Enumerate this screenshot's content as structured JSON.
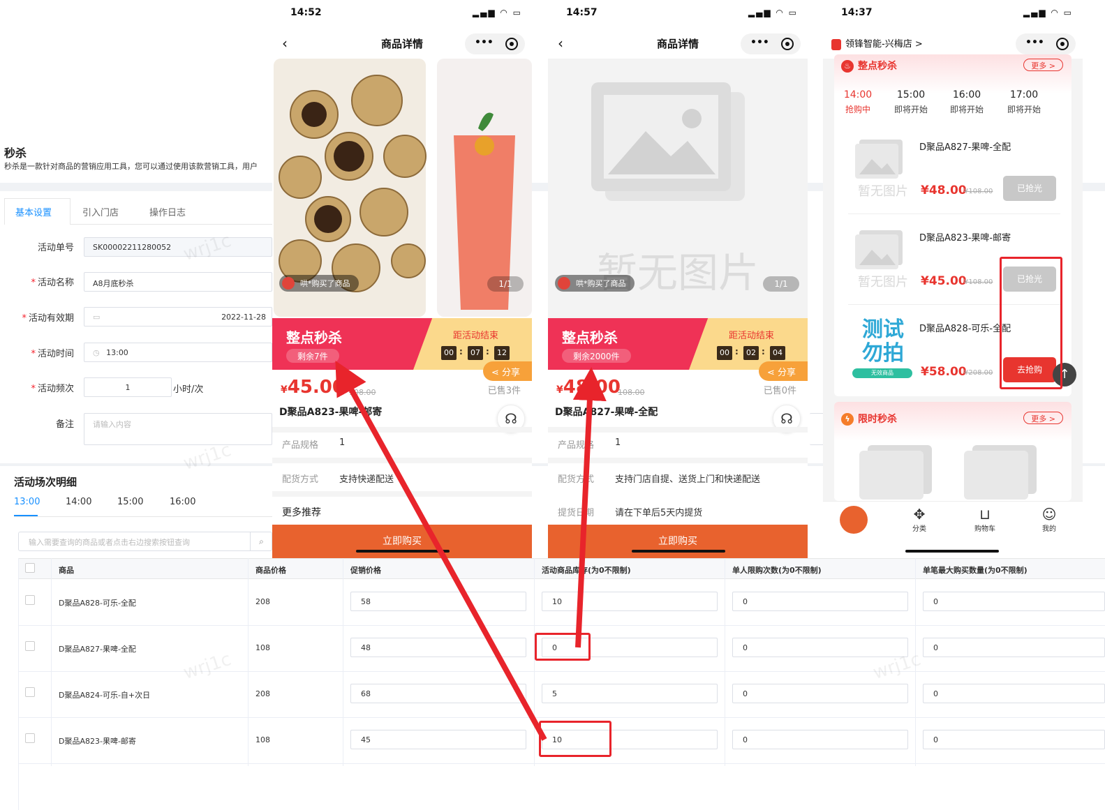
{
  "admin": {
    "page_title": "秒杀",
    "page_desc": "秒杀是一款针对商品的营销应用工具，您可以通过使用该款营销工具，用户",
    "tabs": [
      "基本设置",
      "引入门店",
      "操作日志"
    ],
    "form": {
      "order_no_label": "活动单号",
      "order_no_value": "SK00002211280052",
      "name_label": "活动名称",
      "name_value": "A8月底秒杀",
      "validity_label": "活动有效期",
      "validity_value": "2022-11-28",
      "time_label": "活动时间",
      "time_value": "13:00",
      "freq_label": "活动频次",
      "freq_value": "1",
      "freq_unit": "小时/次",
      "remark_label": "备注",
      "remark_placeholder": "请输入内容"
    },
    "section_title": "活动场次明细",
    "time_tabs": [
      "13:00",
      "14:00",
      "15:00",
      "16:00"
    ],
    "search_placeholder": "输入需要查询的商品或者点击右边搜索按钮查询",
    "search_icon": "search-icon",
    "table": {
      "headers": [
        "商品",
        "商品价格",
        "促销价格",
        "活动商品库存(为0不限制)",
        "单人限购次数(为0不限制)",
        "单笔最大购买数量(为0不限制)"
      ],
      "rows": [
        {
          "name": "D聚品A828-可乐-全配",
          "price": "208",
          "promo": "58",
          "stock": "10",
          "limit": "0",
          "max": "0"
        },
        {
          "name": "D聚品A827-果啤-全配",
          "price": "108",
          "promo": "48",
          "stock": "0",
          "limit": "0",
          "max": "0"
        },
        {
          "name": "D聚品A824-可乐-自+次日",
          "price": "208",
          "promo": "68",
          "stock": "5",
          "limit": "0",
          "max": "0"
        },
        {
          "name": "D聚品A823-果啤-邮寄",
          "price": "108",
          "promo": "45",
          "stock": "10",
          "limit": "0",
          "max": "0"
        }
      ]
    },
    "watermark": "wrj1c"
  },
  "phone1": {
    "time": "14:52",
    "title": "商品详情",
    "buyer": "哄*购买了商品",
    "page": "1/1",
    "flash_title": "整点秒杀",
    "remain": "剩余7件",
    "countdown_label": "距活动结束",
    "countdown": [
      "00",
      "07",
      "12"
    ],
    "share": "分享",
    "price_symbol": "¥",
    "price": "45.00",
    "orig_price": "108.00",
    "sold": "已售3件",
    "product_name": "D聚品A823-果啤-邮寄",
    "spec_label": "产品规格",
    "spec_value": "1",
    "delivery_label": "配货方式",
    "delivery_value": "支持快递配送",
    "more": "更多推荐",
    "buy": "立即购买"
  },
  "phone2": {
    "time": "14:57",
    "title": "商品详情",
    "buyer": "哄*购买了商品",
    "page": "1/1",
    "noimg": "暂无图片",
    "flash_title": "整点秒杀",
    "remain": "剩余2000件",
    "countdown_label": "距活动结束",
    "countdown": [
      "00",
      "02",
      "04"
    ],
    "share": "分享",
    "price_symbol": "¥",
    "price": "48.00",
    "orig_price": "108.00",
    "sold": "已售0件",
    "product_name": "D聚品A827-果啤-全配",
    "spec_label": "产品规格",
    "spec_value": "1",
    "delivery_label": "配货方式",
    "delivery_value": "支持门店自提、送货上门和快递配送",
    "pickup_label": "提货日期",
    "pickup_value": "请在下单后5天内提货",
    "buy": "立即购买"
  },
  "phone3": {
    "time": "14:37",
    "store": "领锋智能-兴梅店 >",
    "section1": "整点秒杀",
    "section2": "限时秒杀",
    "more": "更多 >",
    "slots": [
      {
        "time": "14:00",
        "status": "抢购中"
      },
      {
        "time": "15:00",
        "status": "即将开始"
      },
      {
        "time": "16:00",
        "status": "即将开始"
      },
      {
        "time": "17:00",
        "status": "即将开始"
      }
    ],
    "noimg": "暂无图片",
    "test_img_text": "测试勿拍",
    "test_img_sub": "无效商品",
    "items": [
      {
        "name": "D聚品A827-果啤-全配",
        "price": "¥48.00",
        "orig": "¥108.00",
        "btn": "已抢光"
      },
      {
        "name": "D聚品A823-果啤-邮寄",
        "price": "¥45.00",
        "orig": "¥108.00",
        "btn": "已抢光"
      },
      {
        "name": "D聚品A828-可乐-全配",
        "price": "¥58.00",
        "orig": "¥208.00",
        "btn": "去抢购"
      }
    ],
    "tabbar": [
      "分类",
      "购物车",
      "我的"
    ]
  },
  "colors": {
    "accent_blue": "#1890ff",
    "flash_red": "#ef3256",
    "price_red": "#e8352f",
    "buy_orange": "#e8622e",
    "annotation_red": "#e8242b"
  }
}
